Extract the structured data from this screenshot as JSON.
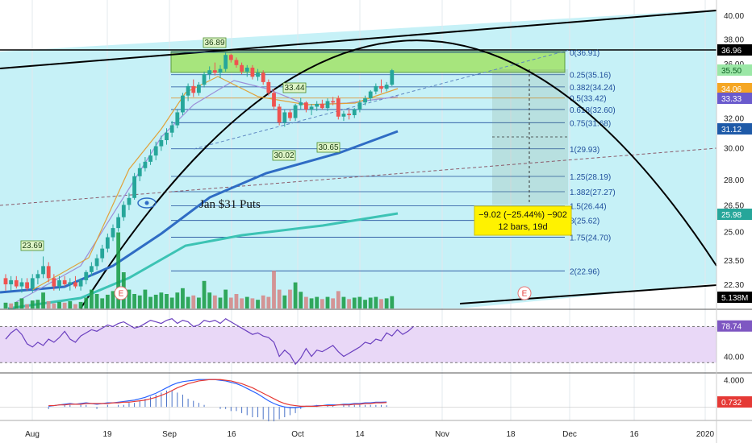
{
  "chart_data": [
    {
      "type": "candlestick",
      "yaxis_ticks": [
        "40.00",
        "38.00",
        "36.00",
        "32.00",
        "30.00",
        "28.00",
        "26.50",
        "25.00",
        "23.50",
        "22.30"
      ],
      "y_scale": "log",
      "ylim": [
        21.6,
        40.5
      ],
      "xaxis_ticks": [
        "Aug",
        "19",
        "Sep",
        "16",
        "Oct",
        "14",
        "Nov",
        "18",
        "Dec",
        "16",
        "2020"
      ],
      "price_badges": [
        {
          "label": "36.96",
          "bg": "#000000",
          "fg": "#ffffff"
        },
        {
          "label": "35.50",
          "bg": "#9be7a6",
          "fg": "#0b5d20"
        },
        {
          "label": "34.06",
          "bg": "#f5a623",
          "fg": "#ffffff"
        },
        {
          "label": "33.33",
          "bg": "#6a5acd",
          "fg": "#ffffff"
        },
        {
          "label": "31.12",
          "bg": "#1e5aa8",
          "fg": "#ffffff"
        },
        {
          "label": "25.98",
          "bg": "#26a69a",
          "fg": "#ffffff"
        },
        {
          "label": "5.138M",
          "bg": "#000000",
          "fg": "#ffffff"
        }
      ],
      "fib_levels": [
        {
          "ratio": 0,
          "price": 36.91,
          "label": "0(36.91)"
        },
        {
          "ratio": 0.25,
          "price": 35.16,
          "label": "0.25(35.16)"
        },
        {
          "ratio": 0.382,
          "price": 34.24,
          "label": "0.382(34.24)"
        },
        {
          "ratio": 0.5,
          "price": 33.42,
          "label": "0.5(33.42)"
        },
        {
          "ratio": 0.618,
          "price": 32.6,
          "label": "0.618(32.60)"
        },
        {
          "ratio": 0.75,
          "price": 31.68,
          "label": "0.75(31.68)"
        },
        {
          "ratio": 1,
          "price": 29.93,
          "label": "1(29.93)"
        },
        {
          "ratio": 1.25,
          "price": 28.19,
          "label": "1.25(28.19)"
        },
        {
          "ratio": 1.382,
          "price": 27.27,
          "label": "1.382(27.27)"
        },
        {
          "ratio": 1.5,
          "price": 26.44,
          "label": "1.5(26.44)"
        },
        {
          "ratio": 1.618,
          "price": 25.62,
          "label": "8(25.62)"
        },
        {
          "ratio": 1.75,
          "price": 24.7,
          "label": "1.75(24.70)"
        },
        {
          "ratio": 2,
          "price": 22.96,
          "label": "2(22.96)"
        }
      ],
      "annotations": {
        "high_label": "36.89",
        "mid_high_label": "33.44",
        "low1_label": "30.02",
        "low2_label": "30.65",
        "low_start_label": "23.69",
        "text_note": "Jan $31 Puts",
        "measure_line1": "−9.02 (−25.44%) −902",
        "measure_line2": "12 bars, 19d",
        "earnings_marker": "E"
      },
      "candles": [
        {
          "o": 22.6,
          "h": 22.8,
          "l": 22.0,
          "c": 22.3
        },
        {
          "o": 22.3,
          "h": 22.7,
          "l": 22.0,
          "c": 22.5
        },
        {
          "o": 22.5,
          "h": 22.7,
          "l": 22.1,
          "c": 22.2
        },
        {
          "o": 22.2,
          "h": 22.6,
          "l": 21.9,
          "c": 22.4
        },
        {
          "o": 22.4,
          "h": 22.6,
          "l": 22.0,
          "c": 22.1
        },
        {
          "o": 22.1,
          "h": 22.8,
          "l": 21.9,
          "c": 22.6
        },
        {
          "o": 22.6,
          "h": 23.0,
          "l": 22.3,
          "c": 22.8
        },
        {
          "o": 22.8,
          "h": 23.69,
          "l": 22.6,
          "c": 23.2
        },
        {
          "o": 23.2,
          "h": 23.4,
          "l": 22.4,
          "c": 22.6
        },
        {
          "o": 22.6,
          "h": 22.8,
          "l": 22.0,
          "c": 22.2
        },
        {
          "o": 22.2,
          "h": 22.7,
          "l": 22.0,
          "c": 22.5
        },
        {
          "o": 22.5,
          "h": 22.7,
          "l": 22.2,
          "c": 22.3
        },
        {
          "o": 22.3,
          "h": 22.6,
          "l": 22.0,
          "c": 22.4
        },
        {
          "o": 22.4,
          "h": 22.7,
          "l": 22.1,
          "c": 22.2
        },
        {
          "o": 22.2,
          "h": 22.6,
          "l": 22.0,
          "c": 22.5
        },
        {
          "o": 22.5,
          "h": 23.0,
          "l": 22.3,
          "c": 22.9
        },
        {
          "o": 22.9,
          "h": 23.4,
          "l": 22.7,
          "c": 23.2
        },
        {
          "o": 23.2,
          "h": 23.8,
          "l": 23.0,
          "c": 23.6
        },
        {
          "o": 23.6,
          "h": 24.3,
          "l": 23.4,
          "c": 24.1
        },
        {
          "o": 24.1,
          "h": 24.9,
          "l": 23.9,
          "c": 24.7
        },
        {
          "o": 24.7,
          "h": 25.4,
          "l": 24.5,
          "c": 25.2
        },
        {
          "o": 25.2,
          "h": 26.0,
          "l": 25.0,
          "c": 25.8
        },
        {
          "o": 25.8,
          "h": 26.7,
          "l": 25.6,
          "c": 26.5
        },
        {
          "o": 26.5,
          "h": 27.2,
          "l": 26.2,
          "c": 26.9
        },
        {
          "o": 26.9,
          "h": 28.4,
          "l": 26.8,
          "c": 28.2
        },
        {
          "o": 28.2,
          "h": 29.0,
          "l": 27.9,
          "c": 28.7
        },
        {
          "o": 28.7,
          "h": 29.4,
          "l": 28.5,
          "c": 29.1
        },
        {
          "o": 29.1,
          "h": 29.9,
          "l": 28.9,
          "c": 29.5
        },
        {
          "o": 29.5,
          "h": 30.4,
          "l": 29.2,
          "c": 30.1
        },
        {
          "o": 30.1,
          "h": 30.8,
          "l": 29.8,
          "c": 30.5
        },
        {
          "o": 30.5,
          "h": 31.3,
          "l": 30.2,
          "c": 31.0
        },
        {
          "o": 31.0,
          "h": 31.8,
          "l": 30.7,
          "c": 31.5
        },
        {
          "o": 31.5,
          "h": 32.6,
          "l": 31.3,
          "c": 32.4
        },
        {
          "o": 32.4,
          "h": 33.8,
          "l": 32.2,
          "c": 33.6
        },
        {
          "o": 33.6,
          "h": 34.5,
          "l": 33.2,
          "c": 34.3
        },
        {
          "o": 34.3,
          "h": 34.8,
          "l": 33.5,
          "c": 33.8
        },
        {
          "o": 33.8,
          "h": 34.6,
          "l": 33.6,
          "c": 34.4
        },
        {
          "o": 34.4,
          "h": 35.4,
          "l": 34.2,
          "c": 35.2
        },
        {
          "o": 35.2,
          "h": 35.8,
          "l": 34.8,
          "c": 35.5
        },
        {
          "o": 35.5,
          "h": 36.1,
          "l": 35.1,
          "c": 35.3
        },
        {
          "o": 35.3,
          "h": 35.9,
          "l": 34.9,
          "c": 35.6
        },
        {
          "o": 35.6,
          "h": 36.89,
          "l": 35.4,
          "c": 36.7
        },
        {
          "o": 36.7,
          "h": 36.8,
          "l": 36.1,
          "c": 36.3
        },
        {
          "o": 36.3,
          "h": 36.5,
          "l": 35.7,
          "c": 35.9
        },
        {
          "o": 35.9,
          "h": 36.1,
          "l": 35.2,
          "c": 35.4
        },
        {
          "o": 35.4,
          "h": 35.9,
          "l": 35.0,
          "c": 35.7
        },
        {
          "o": 35.7,
          "h": 35.9,
          "l": 34.8,
          "c": 35.0
        },
        {
          "o": 35.0,
          "h": 35.6,
          "l": 34.7,
          "c": 35.3
        },
        {
          "o": 35.3,
          "h": 35.5,
          "l": 34.4,
          "c": 34.6
        },
        {
          "o": 34.6,
          "h": 34.8,
          "l": 33.6,
          "c": 33.8
        },
        {
          "o": 33.8,
          "h": 34.1,
          "l": 32.6,
          "c": 32.8
        },
        {
          "o": 32.8,
          "h": 33.0,
          "l": 31.5,
          "c": 31.7
        },
        {
          "o": 31.7,
          "h": 32.6,
          "l": 31.4,
          "c": 32.4
        },
        {
          "o": 32.4,
          "h": 32.6,
          "l": 31.8,
          "c": 32.0
        },
        {
          "o": 32.0,
          "h": 33.0,
          "l": 31.8,
          "c": 32.9
        },
        {
          "o": 32.9,
          "h": 33.44,
          "l": 32.6,
          "c": 33.1
        },
        {
          "o": 33.1,
          "h": 33.2,
          "l": 32.4,
          "c": 32.6
        },
        {
          "o": 32.6,
          "h": 33.0,
          "l": 32.2,
          "c": 32.8
        },
        {
          "o": 32.8,
          "h": 33.2,
          "l": 32.5,
          "c": 33.0
        },
        {
          "o": 33.0,
          "h": 33.3,
          "l": 32.6,
          "c": 32.7
        },
        {
          "o": 32.7,
          "h": 33.4,
          "l": 32.5,
          "c": 33.2
        },
        {
          "o": 33.2,
          "h": 33.5,
          "l": 32.9,
          "c": 33.1
        },
        {
          "o": 33.4,
          "h": 33.6,
          "l": 31.9,
          "c": 32.1
        },
        {
          "o": 32.1,
          "h": 32.5,
          "l": 31.8,
          "c": 32.3
        },
        {
          "o": 32.3,
          "h": 32.6,
          "l": 31.9,
          "c": 32.2
        },
        {
          "o": 32.2,
          "h": 32.7,
          "l": 32.0,
          "c": 32.6
        },
        {
          "o": 32.6,
          "h": 33.3,
          "l": 32.4,
          "c": 33.1
        },
        {
          "o": 33.1,
          "h": 33.6,
          "l": 32.9,
          "c": 33.4
        },
        {
          "o": 33.4,
          "h": 34.0,
          "l": 33.2,
          "c": 33.9
        },
        {
          "o": 33.9,
          "h": 34.5,
          "l": 33.7,
          "c": 34.3
        },
        {
          "o": 34.3,
          "h": 34.8,
          "l": 33.8,
          "c": 34.1
        },
        {
          "o": 34.1,
          "h": 34.6,
          "l": 33.9,
          "c": 34.4
        },
        {
          "o": 34.4,
          "h": 35.6,
          "l": 34.3,
          "c": 35.5
        }
      ],
      "volume": [
        {
          "v": 0.8,
          "up": true
        },
        {
          "v": 0.7,
          "up": false
        },
        {
          "v": 0.9,
          "up": true
        },
        {
          "v": 1.4,
          "up": true
        },
        {
          "v": 0.6,
          "up": false
        },
        {
          "v": 1.1,
          "up": true
        },
        {
          "v": 1.2,
          "up": true
        },
        {
          "v": 2.2,
          "up": true
        },
        {
          "v": 1.0,
          "up": false
        },
        {
          "v": 0.7,
          "up": false
        },
        {
          "v": 0.9,
          "up": true
        },
        {
          "v": 0.8,
          "up": false
        },
        {
          "v": 1.0,
          "up": true
        },
        {
          "v": 0.6,
          "up": false
        },
        {
          "v": 0.9,
          "up": true
        },
        {
          "v": 1.5,
          "up": true
        },
        {
          "v": 2.6,
          "up": true
        },
        {
          "v": 2.0,
          "up": true
        },
        {
          "v": 1.4,
          "up": true
        },
        {
          "v": 1.9,
          "up": true
        },
        {
          "v": 2.4,
          "up": true
        },
        {
          "v": 10.5,
          "up": true
        },
        {
          "v": 5.0,
          "up": true
        },
        {
          "v": 2.6,
          "up": true
        },
        {
          "v": 2.0,
          "up": true
        },
        {
          "v": 1.8,
          "up": true
        },
        {
          "v": 2.6,
          "up": true
        },
        {
          "v": 1.6,
          "up": true
        },
        {
          "v": 1.9,
          "up": true
        },
        {
          "v": 2.2,
          "up": true
        },
        {
          "v": 2.0,
          "up": true
        },
        {
          "v": 1.5,
          "up": true
        },
        {
          "v": 2.2,
          "up": true
        },
        {
          "v": 2.8,
          "up": true
        },
        {
          "v": 1.6,
          "up": true
        },
        {
          "v": 1.8,
          "up": false
        },
        {
          "v": 1.5,
          "up": true
        },
        {
          "v": 3.8,
          "up": true
        },
        {
          "v": 2.2,
          "up": true
        },
        {
          "v": 1.8,
          "up": false
        },
        {
          "v": 1.5,
          "up": true
        },
        {
          "v": 2.6,
          "up": true
        },
        {
          "v": 1.5,
          "up": false
        },
        {
          "v": 2.0,
          "up": false
        },
        {
          "v": 1.4,
          "up": false
        },
        {
          "v": 1.6,
          "up": true
        },
        {
          "v": 1.4,
          "up": false
        },
        {
          "v": 1.2,
          "up": true
        },
        {
          "v": 1.8,
          "up": false
        },
        {
          "v": 1.6,
          "up": false
        },
        {
          "v": 5.2,
          "up": false
        },
        {
          "v": 2.6,
          "up": false
        },
        {
          "v": 1.8,
          "up": true
        },
        {
          "v": 2.6,
          "up": false
        },
        {
          "v": 3.6,
          "up": true
        },
        {
          "v": 2.3,
          "up": true
        },
        {
          "v": 1.6,
          "up": false
        },
        {
          "v": 1.4,
          "up": true
        },
        {
          "v": 1.6,
          "up": true
        },
        {
          "v": 1.3,
          "up": false
        },
        {
          "v": 1.6,
          "up": true
        },
        {
          "v": 1.4,
          "up": false
        },
        {
          "v": 2.4,
          "up": false
        },
        {
          "v": 1.6,
          "up": true
        },
        {
          "v": 1.3,
          "up": false
        },
        {
          "v": 1.5,
          "up": true
        },
        {
          "v": 1.6,
          "up": true
        },
        {
          "v": 1.2,
          "up": true
        },
        {
          "v": 1.5,
          "up": true
        },
        {
          "v": 1.6,
          "up": true
        },
        {
          "v": 1.3,
          "up": false
        },
        {
          "v": 1.4,
          "up": true
        },
        {
          "v": 1.7,
          "up": true
        }
      ],
      "rsi": {
        "value_label": "78.74",
        "ticks": [
          "40.00"
        ],
        "ylim": [
          20,
          100
        ],
        "values": [
          62,
          70,
          75,
          68,
          56,
          52,
          58,
          54,
          62,
          58,
          64,
          72,
          62,
          58,
          66,
          70,
          74,
          72,
          76,
          80,
          78,
          82,
          84,
          80,
          76,
          78,
          82,
          86,
          84,
          82,
          86,
          88,
          82,
          86,
          84,
          78,
          80,
          86,
          84,
          86,
          82,
          88,
          84,
          80,
          76,
          72,
          68,
          70,
          66,
          64,
          58,
          40,
          48,
          42,
          30,
          38,
          50,
          40,
          48,
          46,
          50,
          54,
          46,
          40,
          44,
          48,
          52,
          58,
          56,
          62,
          60,
          70,
          66,
          74,
          68,
          72,
          78
        ]
      },
      "macd": {
        "value_label": "0.732",
        "ticks": [
          "4.000"
        ],
        "ylim": [
          -1.5,
          4.5
        ],
        "macd": [
          0.1,
          0.2,
          0.3,
          0.4,
          0.5,
          0.4,
          0.5,
          0.6,
          0.5,
          0.4,
          0.5,
          0.6,
          0.6,
          0.7,
          0.8,
          0.9,
          1.0,
          1.2,
          1.4,
          1.7,
          2.0,
          2.4,
          2.8,
          3.2,
          3.5,
          3.7,
          3.8,
          3.9,
          4.0,
          4.0,
          4.0,
          4.0,
          3.9,
          3.8,
          3.6,
          3.4,
          3.1,
          2.7,
          2.3,
          1.9,
          1.4,
          0.9,
          0.5,
          0.2,
          0.0,
          -0.1,
          -0.1,
          0.0,
          0.1,
          0.1,
          0.2,
          0.2,
          0.3,
          0.3,
          0.3,
          0.4,
          0.4,
          0.5,
          0.5,
          0.6,
          0.6,
          0.7,
          0.7,
          0.73
        ],
        "signal": [
          0.2,
          0.2,
          0.3,
          0.3,
          0.4,
          0.4,
          0.4,
          0.5,
          0.5,
          0.5,
          0.5,
          0.5,
          0.6,
          0.6,
          0.7,
          0.7,
          0.8,
          0.9,
          1.0,
          1.2,
          1.4,
          1.7,
          2.0,
          2.4,
          2.8,
          3.1,
          3.4,
          3.6,
          3.8,
          3.9,
          4.0,
          4.0,
          4.0,
          3.9,
          3.8,
          3.6,
          3.4,
          3.1,
          2.8,
          2.4,
          2.0,
          1.6,
          1.2,
          0.8,
          0.5,
          0.3,
          0.2,
          0.1,
          0.1,
          0.1,
          0.1,
          0.2,
          0.2,
          0.2,
          0.3,
          0.3,
          0.3,
          0.4,
          0.4,
          0.5,
          0.5,
          0.6,
          0.6,
          0.65
        ]
      }
    }
  ],
  "colors": {
    "bg_channel": "#c6f1f7",
    "fib_shade": "#a7e57d",
    "up": "#26a69a",
    "down": "#ef5350",
    "fib_line": "#1f4e9b",
    "rsi_band": "#e9d8f7",
    "measure_box": "#fff200"
  }
}
